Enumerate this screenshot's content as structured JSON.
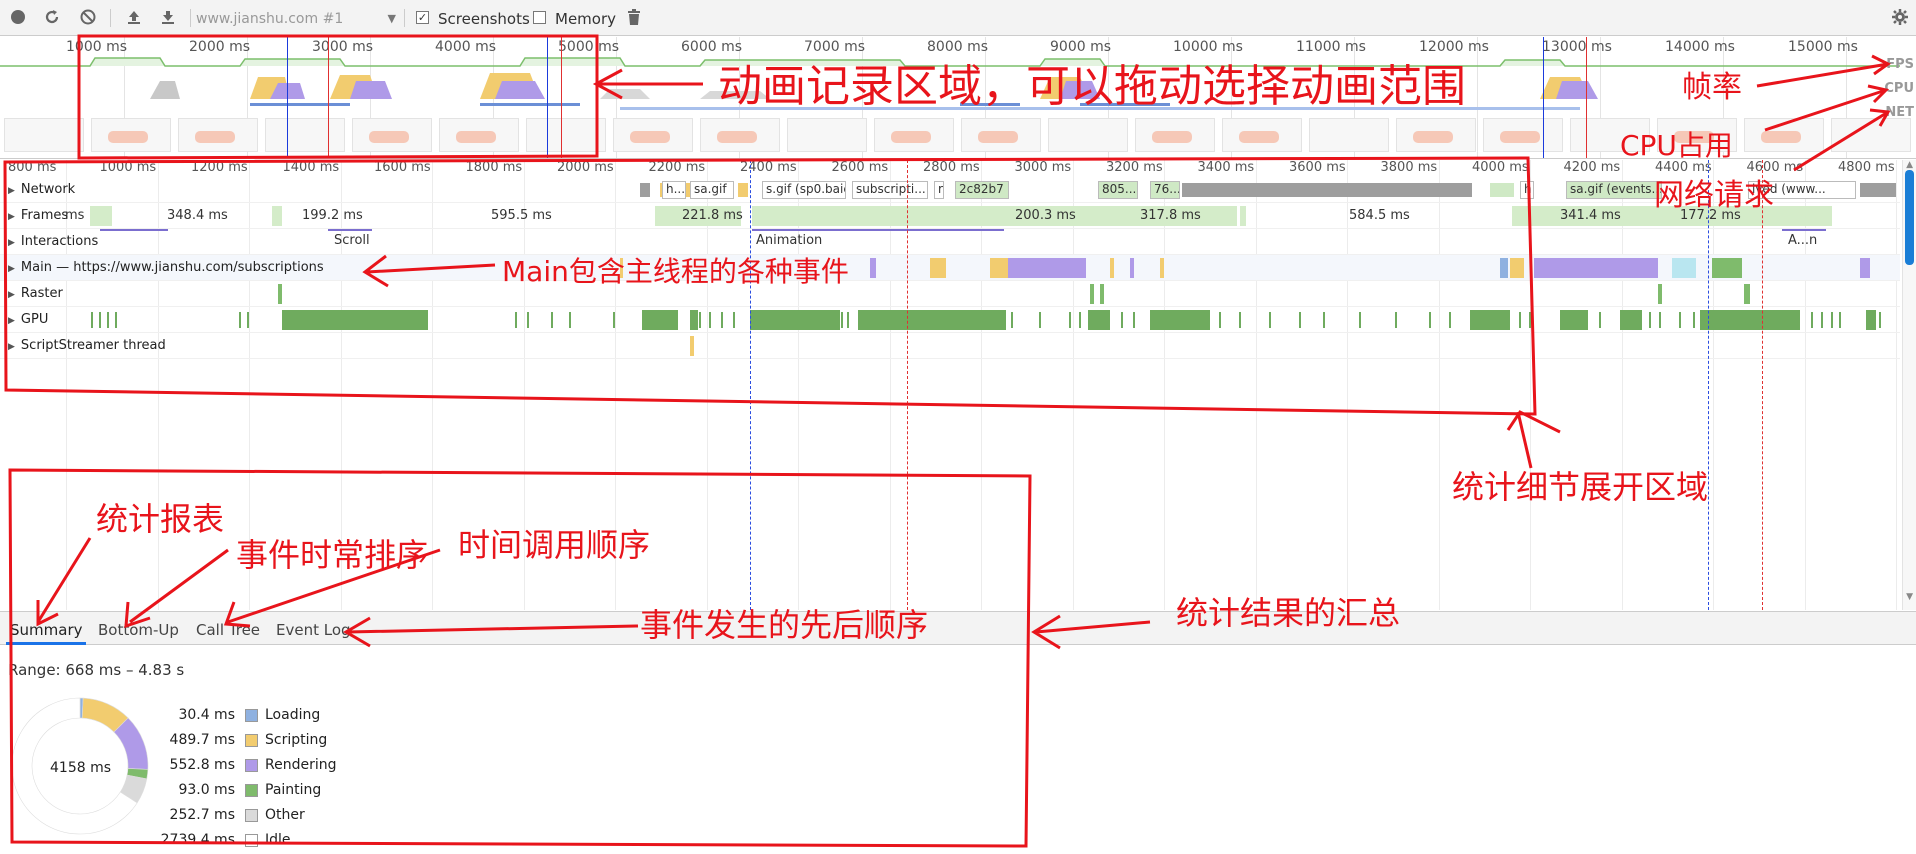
{
  "toolbar": {
    "url_select": "www.jianshu.com #1",
    "screenshots_label": "Screenshots",
    "memory_label": "Memory"
  },
  "overview": {
    "ticks": [
      "1000 ms",
      "2000 ms",
      "3000 ms",
      "4000 ms",
      "5000 ms",
      "6000 ms",
      "7000 ms",
      "8000 ms",
      "9000 ms",
      "10000 ms",
      "11000 ms",
      "12000 ms",
      "13000 ms",
      "14000 ms",
      "15000 ms"
    ],
    "labels": {
      "fps": "FPS",
      "cpu": "CPU",
      "net": "NET"
    }
  },
  "flame": {
    "ticks": [
      "800 ms",
      "1000 ms",
      "1200 ms",
      "1400 ms",
      "1600 ms",
      "1800 ms",
      "2000 ms",
      "2200 ms",
      "2400 ms",
      "2600 ms",
      "2800 ms",
      "3000 ms",
      "3200 ms",
      "3400 ms",
      "3600 ms",
      "3800 ms",
      "4000 ms",
      "4200 ms",
      "4400 ms",
      "4600 ms",
      "4800 ms"
    ],
    "tracks": {
      "network": "Network",
      "frames": "Frames",
      "interactions": "Interactions",
      "main": "Main — https://www.jianshu.com/subscriptions",
      "raster": "Raster",
      "gpu": "GPU",
      "scriptstreamer": "ScriptStreamer thread"
    },
    "frame_times": [
      "348.4 ms",
      "199.2 ms",
      "595.5 ms",
      "221.8 ms",
      "200.3 ms",
      "317.8 ms",
      "584.5 ms",
      "341.4 ms",
      "177.2 ms"
    ],
    "frame_times_partial": "ms",
    "interactions": {
      "scroll": "Scroll",
      "animation": "Animation",
      "short": "A...n"
    },
    "network_items": [
      "h...",
      "sa.gif",
      "s.gif (sp0.baic",
      "subscripti...",
      "r",
      "2c82b7",
      "805...",
      "76...",
      "h",
      "sa.gif (events...",
      "ived (www..."
    ]
  },
  "tabs": [
    "Summary",
    "Bottom-Up",
    "Call Tree",
    "Event Log"
  ],
  "summary": {
    "range": "Range: 668 ms – 4.83 s",
    "total": "4158 ms",
    "legend": [
      {
        "value": "30.4 ms",
        "name": "Loading",
        "color": "#8fb1e0"
      },
      {
        "value": "489.7 ms",
        "name": "Scripting",
        "color": "#f2cc6f"
      },
      {
        "value": "552.8 ms",
        "name": "Rendering",
        "color": "#af9ae8"
      },
      {
        "value": "93.0 ms",
        "name": "Painting",
        "color": "#7fbb6c"
      },
      {
        "value": "252.7 ms",
        "name": "Other",
        "color": "#dadada"
      },
      {
        "value": "2739.4 ms",
        "name": "Idle",
        "color": "#ffffff"
      }
    ]
  },
  "annotations": {
    "anim_record": "动画记录区域，可以拖动选择动画范围",
    "fps": "帧率",
    "cpu": "CPU占用",
    "net": "网络请求",
    "main": "Main包含主线程的各种事件",
    "details": "统计细节展开区域",
    "report": "统计报表",
    "bottom_up": "事件时常排序",
    "call_tree": "时间调用顺序",
    "event_log": "事件发生的先后顺序",
    "summary": "统计结果的汇总"
  }
}
